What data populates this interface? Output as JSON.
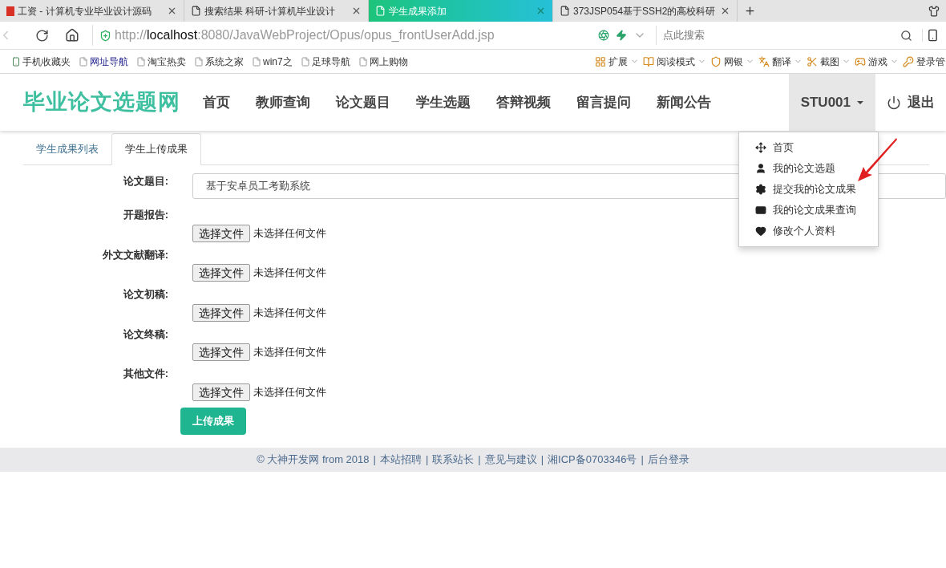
{
  "browser": {
    "tabs": [
      {
        "title": "工资 - 计算机专业毕业设计源码",
        "selected": false
      },
      {
        "title": "搜索结果 科研-计算机毕业设计",
        "selected": false
      },
      {
        "title": "学生成果添加",
        "selected": true
      },
      {
        "title": "373JSP054基于SSH2的高校科研",
        "selected": false
      }
    ],
    "address": {
      "scheme": "http://",
      "host": "localhost",
      "rest": ":8080/JavaWebProject/Opus/opus_frontUserAdd.jsp"
    },
    "search": {
      "placeholder": "点此搜索"
    },
    "bookmarks": [
      {
        "label": "手机收藏夹",
        "kind": "phone"
      },
      {
        "label": "网址导航",
        "kind": "page"
      },
      {
        "label": "淘宝热卖",
        "kind": "page"
      },
      {
        "label": "系统之家",
        "kind": "page"
      },
      {
        "label": "win7之",
        "kind": "page"
      },
      {
        "label": "足球导航",
        "kind": "page"
      },
      {
        "label": "网上购物",
        "kind": "page"
      }
    ],
    "tools": [
      {
        "label": "扩展",
        "kind": "apps"
      },
      {
        "label": "阅读模式",
        "kind": "book"
      },
      {
        "label": "网银",
        "kind": "shield"
      },
      {
        "label": "翻译",
        "kind": "translate"
      },
      {
        "label": "截图",
        "kind": "scissors"
      },
      {
        "label": "游戏",
        "kind": "gamepad"
      },
      {
        "label": "登录管",
        "kind": "key"
      }
    ]
  },
  "site": {
    "logo": "毕业论文选题网",
    "nav": [
      "首页",
      "教师查询",
      "论文题目",
      "学生选题",
      "答辩视频",
      "留言提问",
      "新闻公告"
    ],
    "user": {
      "name": "STU001",
      "expanded": true,
      "menu": [
        {
          "label": "首页",
          "kind": "move"
        },
        {
          "label": "我的论文选题",
          "kind": "user"
        },
        {
          "label": "提交我的论文成果",
          "kind": "gear"
        },
        {
          "label": "我的论文成果查询",
          "kind": "card"
        },
        {
          "label": "修改个人资料",
          "kind": "heart"
        }
      ]
    },
    "logout": "退出"
  },
  "subtabs": [
    {
      "label": "学生成果列表",
      "selected": false
    },
    {
      "label": "学生上传成果",
      "selected": true
    }
  ],
  "form": {
    "fields": [
      {
        "label": "论文题目:",
        "kind": "text",
        "value": "基于安卓员工考勤系统"
      },
      {
        "label": "开题报告:",
        "kind": "file",
        "button": "选择文件",
        "status": "未选择任何文件"
      },
      {
        "label": "外文文献翻译:",
        "kind": "file",
        "button": "选择文件",
        "status": "未选择任何文件"
      },
      {
        "label": "论文初稿:",
        "kind": "file",
        "button": "选择文件",
        "status": "未选择任何文件"
      },
      {
        "label": "论文终稿:",
        "kind": "file",
        "button": "选择文件",
        "status": "未选择任何文件"
      },
      {
        "label": "其他文件:",
        "kind": "file",
        "button": "选择文件",
        "status": "未选择任何文件"
      }
    ],
    "submit": "上传成果"
  },
  "footer": {
    "separator": "|",
    "items": [
      "© 大神开发网 from 2018",
      "本站招聘",
      "联系站长",
      "意见与建议",
      "湘ICP备0703346号",
      "后台登录"
    ]
  }
}
